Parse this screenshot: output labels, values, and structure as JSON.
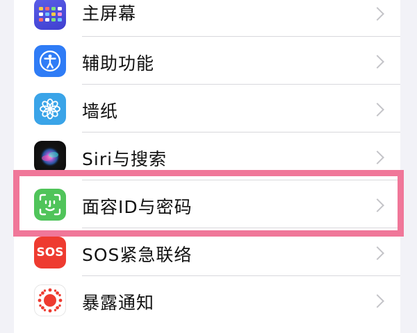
{
  "settings": {
    "items": [
      {
        "label": "主屏幕",
        "icon": "home-screen-icon",
        "icon_color": "#4f52e0"
      },
      {
        "label": "辅助功能",
        "icon": "accessibility-icon",
        "icon_color": "#2f7cf6"
      },
      {
        "label": "墙纸",
        "icon": "wallpaper-icon",
        "icon_color": "#3aa4e8"
      },
      {
        "label": "Siri与搜索",
        "icon": "siri-icon",
        "icon_color": "#0b0b0b"
      },
      {
        "label": "面容ID与密码",
        "icon": "face-id-icon",
        "icon_color": "#50c45a"
      },
      {
        "label": "SOS紧急联络",
        "icon": "sos-icon",
        "icon_color": "#ee3b30",
        "icon_text": "SOS"
      },
      {
        "label": "暴露通知",
        "icon": "exposure-notification-icon",
        "icon_color": "#ee3b30"
      }
    ]
  },
  "highlight": {
    "item": "面容ID与密码",
    "color": "#f07799"
  }
}
